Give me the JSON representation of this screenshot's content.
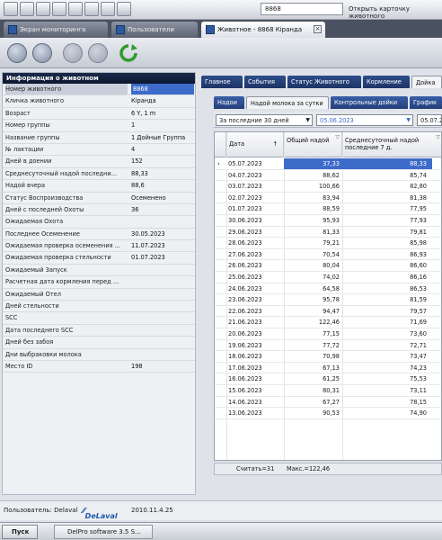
{
  "topbar": {
    "animal_field_value": "8868",
    "open_card_label": "Открыть карточку животного"
  },
  "window_tabs": [
    {
      "label": "Экран мониторинга"
    },
    {
      "label": "Пользователи"
    },
    {
      "label": "Животное - 8868 Кіранда"
    }
  ],
  "info_panel": {
    "title": "Информация о животном",
    "rows": [
      {
        "label": "Номер животного",
        "value": "8868"
      },
      {
        "label": "Кличка животного",
        "value": "Кіранда"
      },
      {
        "label": "Возраст",
        "value": "6 Y, 1 m"
      },
      {
        "label": "Номер группы",
        "value": "1"
      },
      {
        "label": "Название группы",
        "value": "1 Дойные Группа"
      },
      {
        "label": "№ лактации",
        "value": "4"
      },
      {
        "label": "Дней в доении",
        "value": "152"
      },
      {
        "label": "Среднесуточный надой последни...",
        "value": "88,33"
      },
      {
        "label": "Надой вчера",
        "value": "88,6"
      },
      {
        "label": "Статус Воспроизводства",
        "value": "Осеменено"
      },
      {
        "label": "Дней с последней Охоты",
        "value": "36"
      },
      {
        "label": "Ожидаемая Охота",
        "value": ""
      },
      {
        "label": "Последнее Осеменение",
        "value": "30.05.2023"
      },
      {
        "label": "Ожидаемая проверка осеменения ...",
        "value": "11.07.2023"
      },
      {
        "label": "Ожидаемая проверка стельности",
        "value": "01.07.2023"
      },
      {
        "label": "Ожидаемый Запуск",
        "value": ""
      },
      {
        "label": "Расчетная дата кормления перед ...",
        "value": ""
      },
      {
        "label": "Ожидаемый Отел",
        "value": ""
      },
      {
        "label": "Дней стельности",
        "value": ""
      },
      {
        "label": "SCC",
        "value": ""
      },
      {
        "label": "Дата последнего SCC",
        "value": ""
      },
      {
        "label": "Дней без забоя",
        "value": ""
      },
      {
        "label": "Дни выбраковки молока",
        "value": ""
      },
      {
        "label": "Место ID",
        "value": "198"
      }
    ]
  },
  "right_tabs_top": [
    {
      "label": "Главное"
    },
    {
      "label": "События"
    },
    {
      "label": "Статус Животного"
    },
    {
      "label": "Кормление"
    },
    {
      "label": "Дойка"
    }
  ],
  "right_tabs_sub": [
    {
      "label": "Надои"
    },
    {
      "label": "Надой молока за сутки"
    },
    {
      "label": "Контрольные дойки"
    },
    {
      "label": "График"
    }
  ],
  "filter": {
    "period": "За последние 30 дней",
    "from_date": "05.06.2023",
    "to_date": "05.07.2"
  },
  "grid": {
    "headers": {
      "date": "Дата",
      "total_yield": "Общий надой",
      "avg_yield": "Среднесуточный надой последние 7 д."
    },
    "rows": [
      {
        "date": "05.07.2023",
        "yield": "37,33",
        "avg": "88,33"
      },
      {
        "date": "04.07.2023",
        "yield": "88,62",
        "avg": "85,74"
      },
      {
        "date": "03.07.2023",
        "yield": "100,66",
        "avg": "82,80"
      },
      {
        "date": "02.07.2023",
        "yield": "83,94",
        "avg": "81,38"
      },
      {
        "date": "01.07.2023",
        "yield": "88,59",
        "avg": "77,95"
      },
      {
        "date": "30.06.2023",
        "yield": "95,93",
        "avg": "77,93"
      },
      {
        "date": "29.06.2023",
        "yield": "81,33",
        "avg": "79,81"
      },
      {
        "date": "28.06.2023",
        "yield": "79,21",
        "avg": "85,98"
      },
      {
        "date": "27.06.2023",
        "yield": "70,54",
        "avg": "86,93"
      },
      {
        "date": "26.06.2023",
        "yield": "80,04",
        "avg": "86,60"
      },
      {
        "date": "25.06.2023",
        "yield": "74,02",
        "avg": "86,16"
      },
      {
        "date": "24.06.2023",
        "yield": "64,58",
        "avg": "86,53"
      },
      {
        "date": "23.06.2023",
        "yield": "95,78",
        "avg": "81,59"
      },
      {
        "date": "22.06.2023",
        "yield": "94,47",
        "avg": "79,57"
      },
      {
        "date": "21.06.2023",
        "yield": "122,46",
        "avg": "71,69"
      },
      {
        "date": "20.06.2023",
        "yield": "77,15",
        "avg": "73,60"
      },
      {
        "date": "19.06.2023",
        "yield": "77,72",
        "avg": "72,71"
      },
      {
        "date": "18.06.2023",
        "yield": "70,98",
        "avg": "73,47"
      },
      {
        "date": "17.06.2023",
        "yield": "67,13",
        "avg": "74,23"
      },
      {
        "date": "16.06.2023",
        "yield": "61,25",
        "avg": "75,53"
      },
      {
        "date": "15.06.2023",
        "yield": "80,31",
        "avg": "73,11"
      },
      {
        "date": "14.06.2023",
        "yield": "67,27",
        "avg": "78,15"
      },
      {
        "date": "13.06.2023",
        "yield": "90,53",
        "avg": "74,90"
      }
    ],
    "footer_count": "Считать=31",
    "footer_max": "Макс.=122,46"
  },
  "statusbar": {
    "users": "Пользователь: Delaval",
    "brand": "DeLaval",
    "version": "2010.11.4.25"
  },
  "taskbar": {
    "start": "Пуск",
    "app": "DelPro software 3.5 S..."
  },
  "colors": {
    "selection": "#3d6bc9",
    "tab_blue": "#2d4d8a",
    "header_dark": "#0c1730"
  }
}
